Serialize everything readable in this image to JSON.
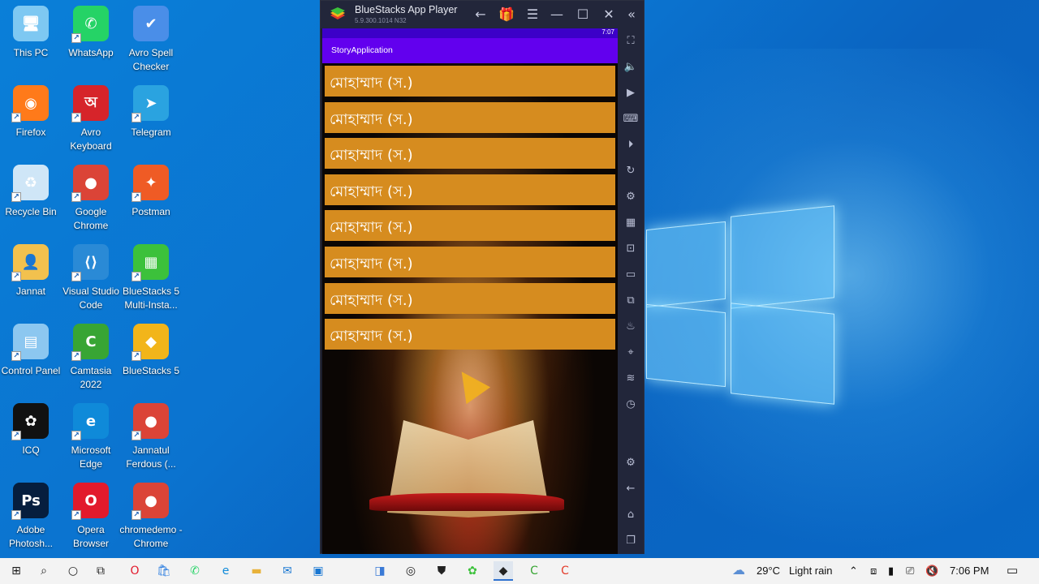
{
  "desktop": {
    "icons": [
      {
        "label": "This PC",
        "glyph": "🖥",
        "color": "#7ec8f2"
      },
      {
        "label": "WhatsApp",
        "glyph": "✆",
        "color": "#25d366"
      },
      {
        "label": "Avro Spell Checker",
        "glyph": "✔",
        "color": "#4a8ee8"
      },
      {
        "label": "Firefox",
        "glyph": "◉",
        "color": "#ff7a1a"
      },
      {
        "label": "Avro Keyboard",
        "glyph": "অ",
        "color": "#d6242a"
      },
      {
        "label": "Telegram",
        "glyph": "➤",
        "color": "#2aa3e0"
      },
      {
        "label": "Recycle Bin",
        "glyph": "♻",
        "color": "#cfe6f7"
      },
      {
        "label": "Google Chrome",
        "glyph": "●",
        "color": "#db4437"
      },
      {
        "label": "Postman",
        "glyph": "✦",
        "color": "#ef5b25"
      },
      {
        "label": "Jannat",
        "glyph": "👤",
        "color": "#f2c14e"
      },
      {
        "label": "Visual Studio Code",
        "glyph": "⟨⟩",
        "color": "#2a8ad6"
      },
      {
        "label": "BlueStacks 5 Multi-Insta...",
        "glyph": "▦",
        "color": "#3cc13b"
      },
      {
        "label": "Control Panel",
        "glyph": "▤",
        "color": "#8cc7f0"
      },
      {
        "label": "Camtasia 2022",
        "glyph": "C",
        "color": "#38a534"
      },
      {
        "label": "BlueStacks 5",
        "glyph": "◆",
        "color": "#f2b51a"
      },
      {
        "label": "ICQ",
        "glyph": "✿",
        "color": "#111111"
      },
      {
        "label": "Microsoft Edge",
        "glyph": "e",
        "color": "#0f8ad9"
      },
      {
        "label": "Jannatul Ferdous (...",
        "glyph": "●",
        "color": "#db4437"
      },
      {
        "label": "Adobe Photosh...",
        "glyph": "Ps",
        "color": "#061e3e"
      },
      {
        "label": "Opera Browser",
        "glyph": "O",
        "color": "#e21a2c"
      },
      {
        "label": "chromedemo - Chrome",
        "glyph": "●",
        "color": "#db4437"
      }
    ]
  },
  "bluestacks": {
    "title": "BlueStacks App Player",
    "version": "5.9.300.1014  N32",
    "toolbar": [
      "back-icon",
      "gift-icon",
      "menu-icon",
      "minimize-icon",
      "maximize-icon",
      "close-icon",
      "collapse-icon"
    ],
    "sidebar": [
      "fullscreen-icon",
      "volume-icon",
      "screen-record-icon",
      "keyboard-icon",
      "macro-icon",
      "rotate-icon",
      "controls-icon",
      "apk-icon",
      "screenshot-icon",
      "folder-icon",
      "multi-instance-icon",
      "eco-mode-icon",
      "location-icon",
      "layers-icon",
      "performance-icon",
      "settings-icon",
      "android-back-icon",
      "home-icon",
      "recents-icon"
    ]
  },
  "android": {
    "status_time": "7:07",
    "app_title": "StoryApplication",
    "items": [
      "মোহাম্মাদ (স.)",
      "মোহাম্মাদ (স.)",
      "মোহাম্মাদ (স.)",
      "মোহাম্মাদ (স.)",
      "মোহাম্মাদ (স.)",
      "মোহাম্মাদ (স.)",
      "মোহাম্মাদ (স.)",
      "মোহাম্মাদ (স.)"
    ]
  },
  "taskbar": {
    "weather_temp": "29°C",
    "weather_desc": "Light rain",
    "time": "7:06 PM"
  },
  "colors": {
    "app_bar": "#6200ee",
    "list_item": "#d68c1f",
    "taskbar": "#f3f3f3"
  }
}
